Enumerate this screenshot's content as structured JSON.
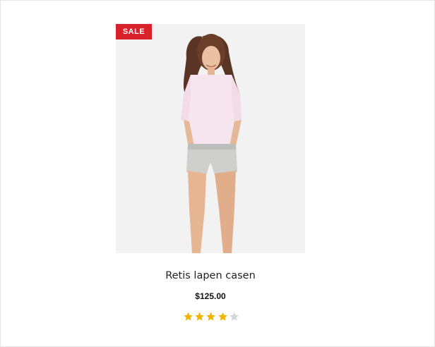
{
  "product": {
    "badge": "SALE",
    "name": "Retis lapen casen",
    "price": "$125.00",
    "rating": 4,
    "rating_max": 5,
    "image_description_icon": "product-photo"
  },
  "colors": {
    "badge_bg": "#d8212a",
    "star_filled": "#f5b301",
    "star_empty": "#d6d6d6",
    "image_bg": "#f2f2f2"
  }
}
